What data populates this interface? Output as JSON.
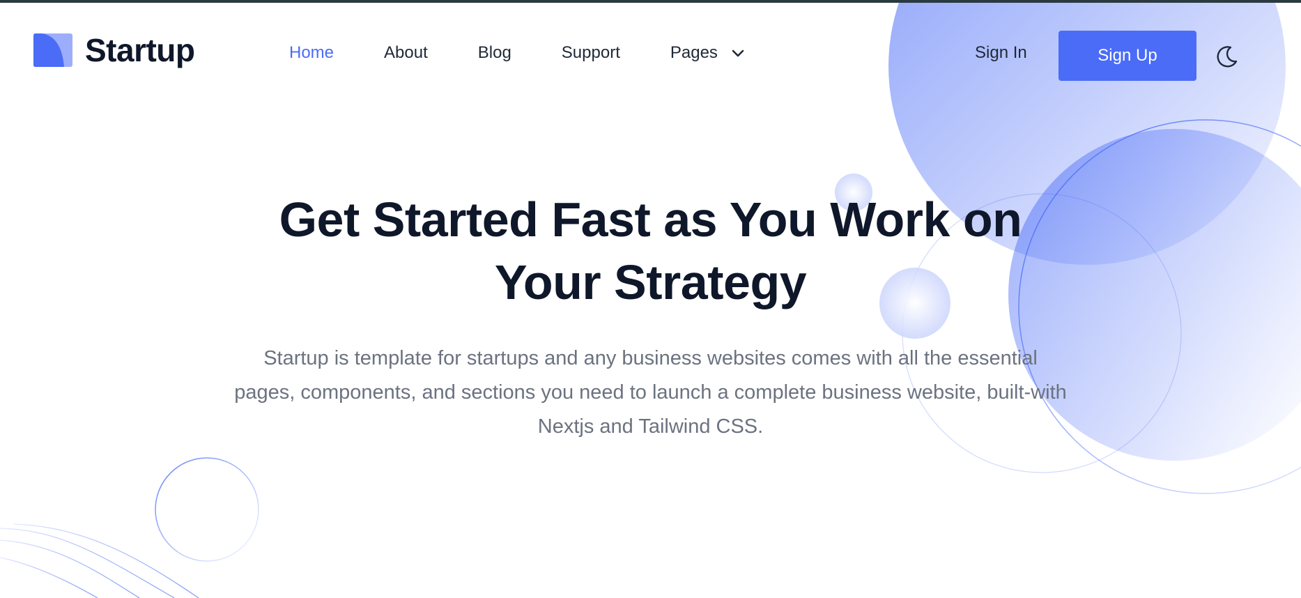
{
  "brand": {
    "name": "Startup",
    "logo_icon": "startup-logo-icon",
    "accent": "#4a6cf7"
  },
  "nav": {
    "items": [
      {
        "label": "Home",
        "active": true
      },
      {
        "label": "About",
        "active": false
      },
      {
        "label": "Blog",
        "active": false
      },
      {
        "label": "Support",
        "active": false
      },
      {
        "label": "Pages",
        "active": false
      }
    ],
    "pages_icon": "chevron-down-icon"
  },
  "auth": {
    "signin_label": "Sign In",
    "signup_label": "Sign Up"
  },
  "theme_toggle": {
    "icon": "moon-icon"
  },
  "hero": {
    "title": "Get Started Fast as You Work on Your Strategy",
    "description": "Startup is template for startups and any business websites comes with all the essential pages, components, and sections you need to launch a complete business website, built-with Nextjs and Tailwind CSS."
  },
  "colors": {
    "accent": "#4a6cf7",
    "text_dark": "#0f172a",
    "text_muted": "#6b7280",
    "top_strip": "#2b3a40"
  }
}
